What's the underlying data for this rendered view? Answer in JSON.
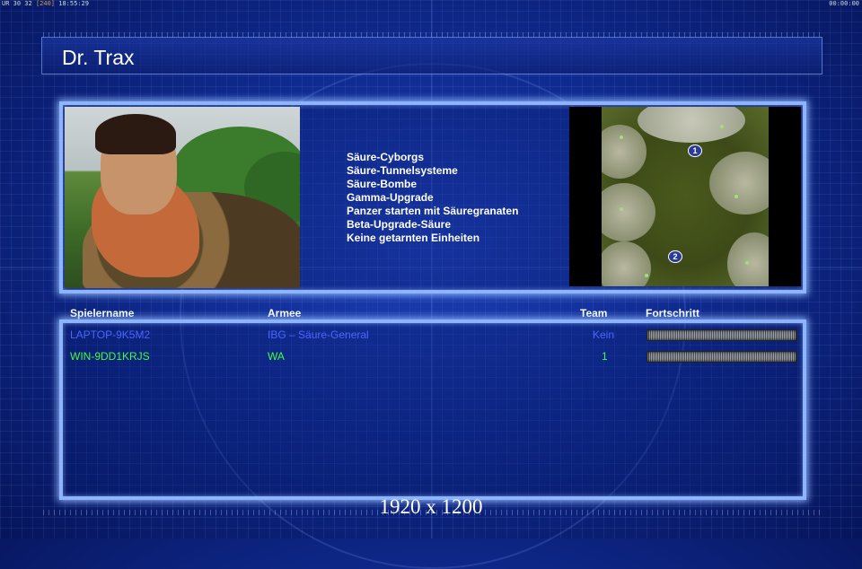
{
  "status": {
    "left_prefix": "UR 30 32",
    "left_fps": "[240]",
    "left_time": "18:55:29",
    "right_time": "00:00:00"
  },
  "general": {
    "name": "Dr. Trax"
  },
  "abilities": [
    "Säure-Cyborgs",
    "Säure-Tunnelsysteme",
    "Säure-Bombe",
    "Gamma-Upgrade",
    "Panzer starten mit Säuregranaten",
    "Beta-Upgrade-Säure",
    "Keine getarnten Einheiten"
  ],
  "map": {
    "markers": [
      "1",
      "2"
    ]
  },
  "players_table": {
    "headers": {
      "name": "Spielername",
      "army": "Armee",
      "team": "Team",
      "progress": "Fortschritt"
    },
    "rows": [
      {
        "name": "LAPTOP-9K5M2",
        "army": "IBG – Säure-General",
        "team": "Kein",
        "color": "#4b64ff"
      },
      {
        "name": "WIN-9DD1KRJS",
        "army": "WA",
        "team": "1",
        "color": "#3cff3c"
      }
    ]
  },
  "resolution_label": "1920 x 1200"
}
